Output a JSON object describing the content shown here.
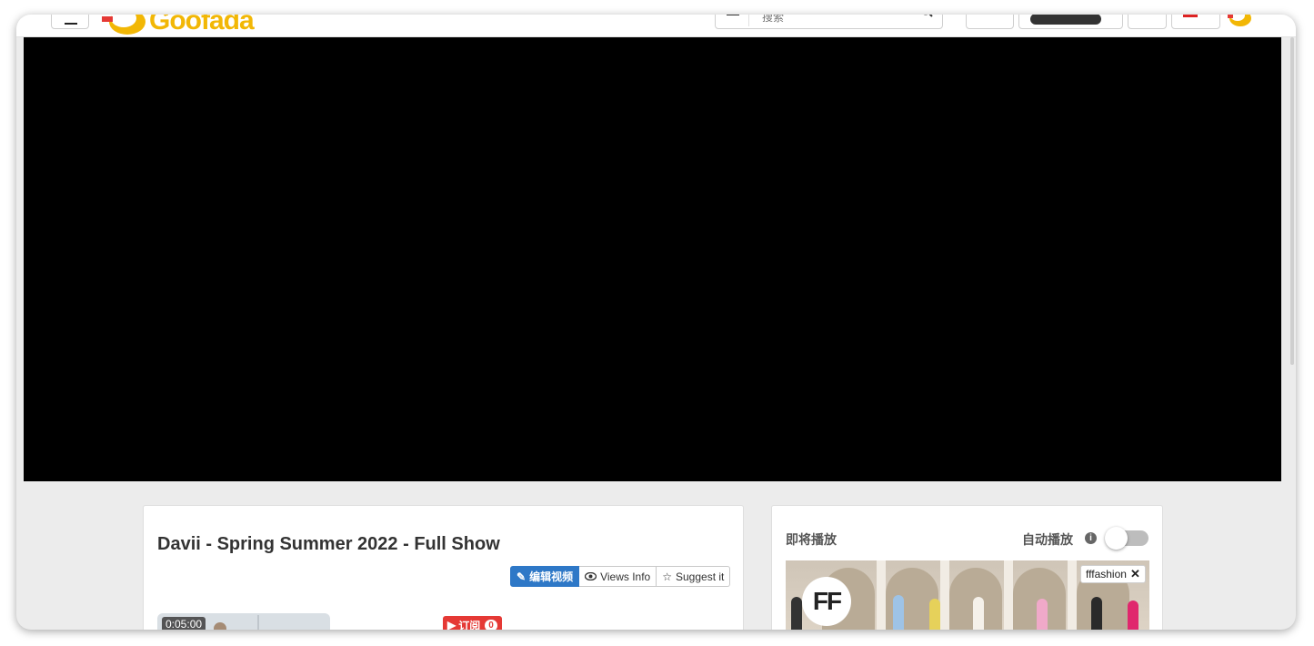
{
  "header": {
    "logo_text": "Goofada",
    "search_placeholder": "搜索",
    "search_icon": "search-icon"
  },
  "video": {
    "title": "Davii - Spring Summer 2022 - Full Show",
    "actions": {
      "edit_label": "编辑视频",
      "views_label": "Views Info",
      "suggest_label": "Suggest it"
    },
    "duration": "0:05:00",
    "subscribe_label": "订阅",
    "subscribe_count": "0"
  },
  "sidebar": {
    "up_next_label": "即将播放",
    "autoplay_label": "自动播放",
    "autoplay_on": false,
    "next_thumb": {
      "logo_text": "FF",
      "channel_tag": "fffashion"
    }
  },
  "colors": {
    "accent_blue": "#2e78c7",
    "subscribe_red": "#e53935",
    "logo_yellow": "#f2b705",
    "background": "#ececec"
  }
}
